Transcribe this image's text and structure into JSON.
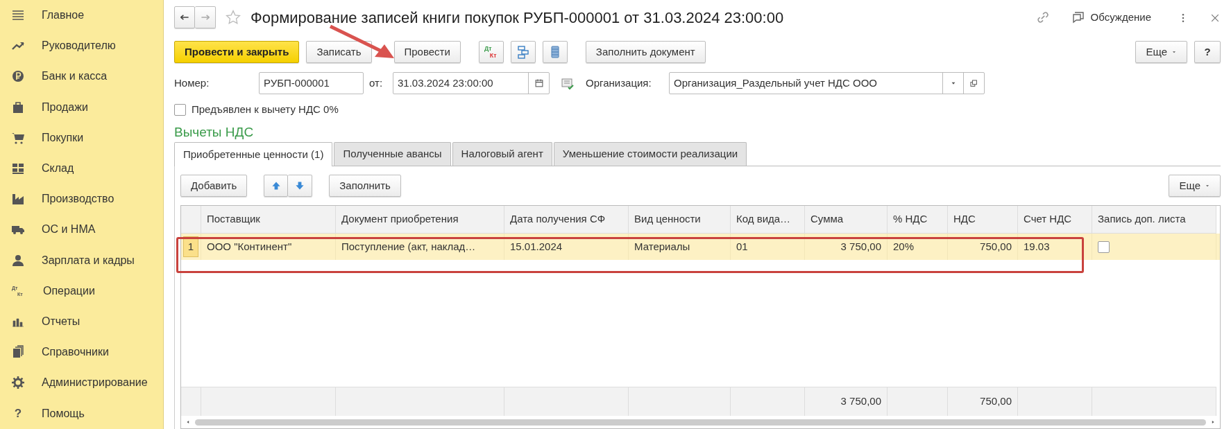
{
  "sidebar": {
    "items": [
      {
        "label": "Главное"
      },
      {
        "label": "Руководителю"
      },
      {
        "label": "Банк и касса"
      },
      {
        "label": "Продажи"
      },
      {
        "label": "Покупки"
      },
      {
        "label": "Склад"
      },
      {
        "label": "Производство"
      },
      {
        "label": "ОС и НМА"
      },
      {
        "label": "Зарплата и кадры"
      },
      {
        "label": "Операции",
        "icon_text": [
          "Дт",
          "Кт"
        ]
      },
      {
        "label": "Отчеты"
      },
      {
        "label": "Справочники"
      },
      {
        "label": "Администрирование"
      },
      {
        "label": "Помощь",
        "icon_text": "?"
      }
    ]
  },
  "window": {
    "title": "Формирование записей книги покупок РУБП-000001 от 31.03.2024 23:00:00",
    "discussion": "Обсуждение"
  },
  "toolbar": {
    "buttons": [
      {
        "kind": "primary",
        "label": "Провести и закрыть"
      },
      {
        "kind": "text",
        "label": "Записать"
      },
      {
        "kind": "text",
        "label": "Провести"
      },
      {
        "kind": "dtkt",
        "icon_text": [
          "Дт",
          "Кт"
        ]
      },
      {
        "kind": "structure"
      },
      {
        "kind": "list"
      },
      {
        "kind": "text",
        "label": "Заполнить документ"
      }
    ],
    "more": "Еще",
    "help": "?"
  },
  "fields": {
    "number_label": "Номер:",
    "number": "РУБП-000001",
    "date_label": "от:",
    "date": "31.03.2024 23:00:00",
    "org_label": "Организация:",
    "org": "Организация_Раздельный учет НДС ООО"
  },
  "checkbox": {
    "label": "Предъявлен к вычету НДС 0%",
    "checked": false
  },
  "section_title": "Вычеты НДС",
  "tabs": [
    {
      "label": "Приобретенные ценности (1)",
      "selected": true
    },
    {
      "label": "Полученные авансы",
      "selected": false
    },
    {
      "label": "Налоговый агент",
      "selected": false
    },
    {
      "label": "Уменьшение стоимости реализации",
      "selected": false
    }
  ],
  "table_toolbar": {
    "add": "Добавить",
    "fill": "Заполнить",
    "more": "Еще"
  },
  "table": {
    "columns": [
      {
        "label": "Поставщик",
        "numeric": false
      },
      {
        "label": "Документ приобретения",
        "numeric": false
      },
      {
        "label": "Дата получения СФ",
        "numeric": false
      },
      {
        "label": "Вид ценности",
        "numeric": false
      },
      {
        "label": "Код вида…",
        "numeric": false
      },
      {
        "label": "Сумма",
        "numeric": true
      },
      {
        "label": "% НДС",
        "numeric": false
      },
      {
        "label": "НДС",
        "numeric": true
      },
      {
        "label": "Счет НДС",
        "numeric": false
      },
      {
        "label": "Запись доп. листа",
        "numeric": false
      }
    ],
    "rows": [
      {
        "number": "1",
        "selected": true,
        "cells": [
          "ООО \"Континент\"",
          "Поступление (акт, наклад…",
          "15.01.2024",
          "Материалы",
          "01",
          "3 750,00",
          "20%",
          "750,00",
          "19.03"
        ],
        "extra_sheet": false
      }
    ],
    "totals": {
      "sum": "3 750,00",
      "vat": "750,00"
    }
  }
}
